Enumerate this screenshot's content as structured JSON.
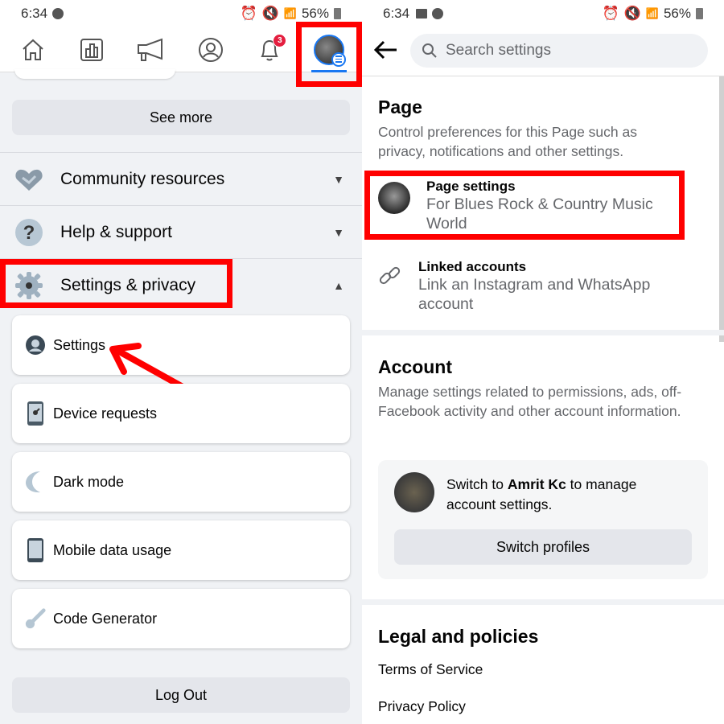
{
  "left": {
    "status": {
      "time": "6:34",
      "battery": "56%"
    },
    "nav": {
      "tabs": [
        "home",
        "insights",
        "ads",
        "profile",
        "notifications",
        "menu"
      ],
      "notification_count": "3"
    },
    "see_more": "See more",
    "accordions": [
      {
        "label": "Community resources",
        "icon": "handshake-icon",
        "expanded": false
      },
      {
        "label": "Help & support",
        "icon": "question-icon",
        "expanded": false
      },
      {
        "label": "Settings & privacy",
        "icon": "gear-icon",
        "expanded": true
      }
    ],
    "menu_items": [
      {
        "label": "Settings",
        "icon": "user-circle-icon"
      },
      {
        "label": "Device requests",
        "icon": "device-icon"
      },
      {
        "label": "Dark mode",
        "icon": "moon-icon"
      },
      {
        "label": "Mobile data usage",
        "icon": "phone-icon"
      },
      {
        "label": "Code Generator",
        "icon": "key-icon"
      }
    ],
    "logout": "Log Out"
  },
  "right": {
    "status": {
      "time": "6:34",
      "battery": "56%"
    },
    "search": {
      "placeholder": "Search settings"
    },
    "page_section": {
      "title": "Page",
      "description": "Control preferences for this Page such as privacy, notifications and other settings.",
      "items": [
        {
          "title": "Page settings",
          "subtitle": "For Blues Rock & Country Music World"
        },
        {
          "title": "Linked accounts",
          "subtitle": "Link an Instagram and WhatsApp account"
        }
      ]
    },
    "account_section": {
      "title": "Account",
      "description": "Manage settings related to permissions, ads, off-Facebook activity and other account information.",
      "switch_prefix": "Switch to ",
      "switch_name": "Amrit Kc",
      "switch_suffix": " to manage account settings.",
      "switch_button": "Switch profiles"
    },
    "legal_section": {
      "title": "Legal and policies",
      "links": [
        "Terms of Service",
        "Privacy Policy"
      ]
    }
  },
  "annotations": {
    "highlight_color": "#ff0000",
    "accent": "#1877f2"
  }
}
